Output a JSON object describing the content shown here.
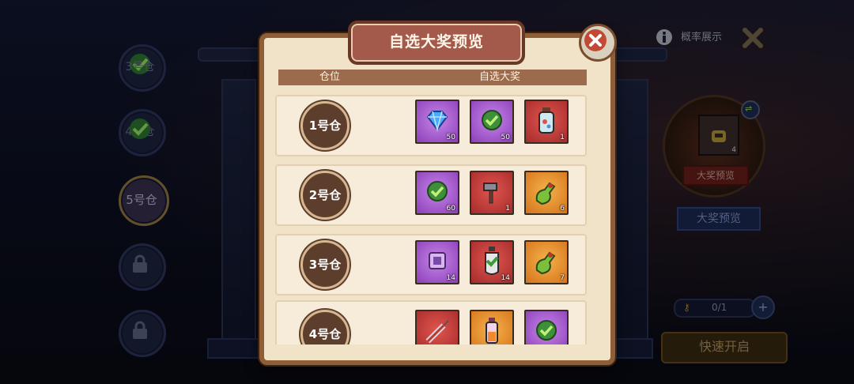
{
  "background": {
    "side_slots": [
      {
        "label": "3号仓",
        "state": "checked"
      },
      {
        "label": "4号仓",
        "state": "checked"
      },
      {
        "label": "5号仓",
        "state": "active"
      },
      {
        "label": "",
        "state": "locked"
      },
      {
        "label": "",
        "state": "locked"
      }
    ],
    "top_bar": {
      "probability_label": "概率展示"
    },
    "prize_panel": {
      "badge_label": "大奖预览",
      "item_count": "4",
      "preview_button": "大奖预览"
    },
    "key_counter": "0/1",
    "quick_open_button": "快速开启"
  },
  "modal": {
    "title": "自选大奖预览",
    "columns": {
      "slot": "仓位",
      "prizes": "自选大奖"
    },
    "rows": [
      {
        "slot": "1号仓",
        "items": [
          {
            "icon": "blue-gem-icon",
            "rarity": "purple",
            "qty": "50"
          },
          {
            "icon": "green-check-icon",
            "rarity": "purple",
            "qty": "50"
          },
          {
            "icon": "potion-bottle-icon",
            "rarity": "red",
            "qty": "1"
          }
        ]
      },
      {
        "slot": "2号仓",
        "items": [
          {
            "icon": "green-check-icon",
            "rarity": "purple",
            "qty": "60"
          },
          {
            "icon": "hammer-icon",
            "rarity": "red",
            "qty": "1"
          },
          {
            "icon": "green-pouch-icon",
            "rarity": "orange",
            "qty": "6"
          }
        ]
      },
      {
        "slot": "3号仓",
        "items": [
          {
            "icon": "purple-chip-icon",
            "rarity": "purple",
            "qty": "14"
          },
          {
            "icon": "green-potion-icon",
            "rarity": "red",
            "qty": "14"
          },
          {
            "icon": "green-pouch-icon",
            "rarity": "orange",
            "qty": "7"
          }
        ]
      },
      {
        "slot": "4号仓",
        "items": [
          {
            "icon": "syringe-icon",
            "rarity": "red",
            "qty": ""
          },
          {
            "icon": "orange-vial-icon",
            "rarity": "orange",
            "qty": ""
          },
          {
            "icon": "green-check-icon",
            "rarity": "purple",
            "qty": ""
          }
        ]
      }
    ]
  },
  "colors": {
    "frame": "#8e5e38",
    "parchment": "#f1e3c8",
    "header": "#9c6a4c",
    "close": "#c24a35"
  }
}
